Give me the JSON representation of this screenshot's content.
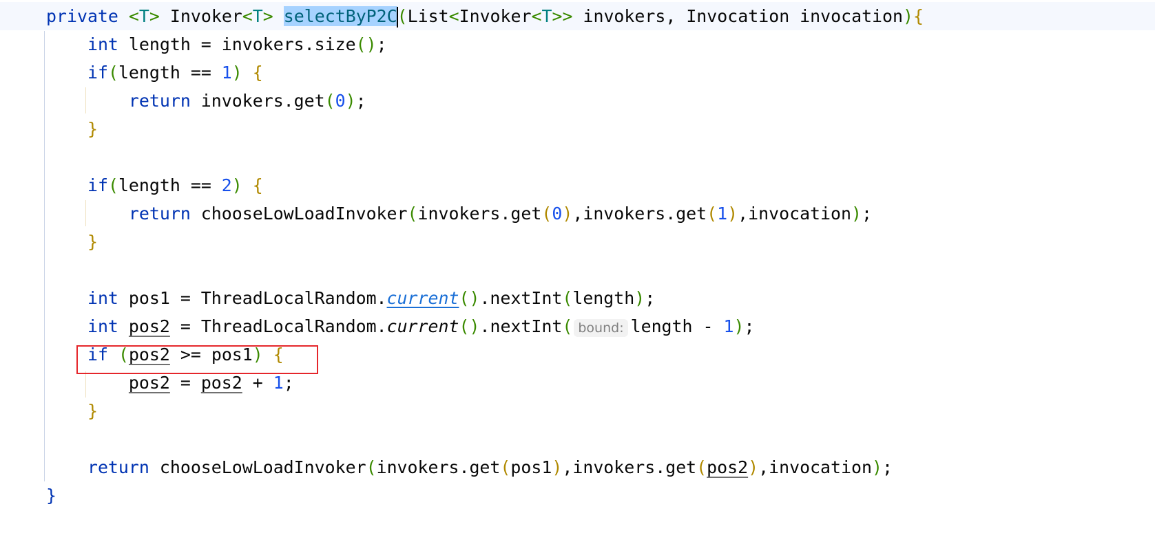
{
  "editor": {
    "lines": [
      [
        {
          "t": "private",
          "c": "kw"
        },
        {
          "t": " "
        },
        {
          "t": "<",
          "c": "ang"
        },
        {
          "t": "T",
          "c": "gen"
        },
        {
          "t": ">",
          "c": "ang"
        },
        {
          "t": " Invoker"
        },
        {
          "t": "<",
          "c": "ang"
        },
        {
          "t": "T",
          "c": "gen"
        },
        {
          "t": ">",
          "c": "ang"
        },
        {
          "t": " "
        },
        {
          "t": "selectByP2C",
          "c": "decl"
        },
        {
          "t": "",
          "c": "caret"
        },
        {
          "t": "(",
          "c": "p1"
        },
        {
          "t": "List"
        },
        {
          "t": "<",
          "c": "ang"
        },
        {
          "t": "Invoker"
        },
        {
          "t": "<",
          "c": "ang"
        },
        {
          "t": "T",
          "c": "gen"
        },
        {
          "t": ">>",
          "c": "ang"
        },
        {
          "t": " invokers, Invocation invocation"
        },
        {
          "t": ")",
          "c": "p1"
        },
        {
          "t": "{",
          "c": "br"
        }
      ],
      [
        {
          "t": "    "
        },
        {
          "t": "int",
          "c": "kw"
        },
        {
          "t": " length = invokers.size"
        },
        {
          "t": "()",
          "c": "p1"
        },
        {
          "t": ";"
        }
      ],
      [
        {
          "t": "    "
        },
        {
          "t": "if",
          "c": "kw"
        },
        {
          "t": "(",
          "c": "p1"
        },
        {
          "t": "length == "
        },
        {
          "t": "1",
          "c": "num"
        },
        {
          "t": ")",
          "c": "p1"
        },
        {
          "t": " "
        },
        {
          "t": "{",
          "c": "br"
        }
      ],
      [
        {
          "t": "        "
        },
        {
          "t": "return",
          "c": "kw"
        },
        {
          "t": " invokers.get"
        },
        {
          "t": "(",
          "c": "p1"
        },
        {
          "t": "0",
          "c": "num"
        },
        {
          "t": ")",
          "c": "p1"
        },
        {
          "t": ";"
        }
      ],
      [
        {
          "t": "    "
        },
        {
          "t": "}",
          "c": "br"
        }
      ],
      [],
      [
        {
          "t": "    "
        },
        {
          "t": "if",
          "c": "kw"
        },
        {
          "t": "(",
          "c": "p1"
        },
        {
          "t": "length == "
        },
        {
          "t": "2",
          "c": "num"
        },
        {
          "t": ")",
          "c": "p1"
        },
        {
          "t": " "
        },
        {
          "t": "{",
          "c": "br"
        }
      ],
      [
        {
          "t": "        "
        },
        {
          "t": "return",
          "c": "kw"
        },
        {
          "t": " chooseLowLoadInvoker"
        },
        {
          "t": "(",
          "c": "p1"
        },
        {
          "t": "invokers.get"
        },
        {
          "t": "(",
          "c": "br"
        },
        {
          "t": "0",
          "c": "num"
        },
        {
          "t": ")",
          "c": "br"
        },
        {
          "t": ",invokers.get"
        },
        {
          "t": "(",
          "c": "br"
        },
        {
          "t": "1",
          "c": "num"
        },
        {
          "t": ")",
          "c": "br"
        },
        {
          "t": ",invocation"
        },
        {
          "t": ")",
          "c": "p1"
        },
        {
          "t": ";"
        }
      ],
      [
        {
          "t": "    "
        },
        {
          "t": "}",
          "c": "br"
        }
      ],
      [],
      [
        {
          "t": "    "
        },
        {
          "t": "int",
          "c": "kw"
        },
        {
          "t": " pos1 = ThreadLocalRandom."
        },
        {
          "t": "current",
          "c": "link"
        },
        {
          "t": "()",
          "c": "p1"
        },
        {
          "t": ".nextInt"
        },
        {
          "t": "(",
          "c": "p1"
        },
        {
          "t": "length"
        },
        {
          "t": ")",
          "c": "p1"
        },
        {
          "t": ";"
        }
      ],
      [
        {
          "t": "    "
        },
        {
          "t": "int",
          "c": "kw"
        },
        {
          "t": " "
        },
        {
          "t": "pos2",
          "c": "reass"
        },
        {
          "t": " = ThreadLocalRandom."
        },
        {
          "t": "current",
          "c": "ital"
        },
        {
          "t": "()",
          "c": "p1"
        },
        {
          "t": ".nextInt"
        },
        {
          "t": "(",
          "c": "p1"
        },
        {
          "t": "bound:",
          "c": "hint"
        },
        {
          "t": "length - "
        },
        {
          "t": "1",
          "c": "num"
        },
        {
          "t": ")",
          "c": "p1"
        },
        {
          "t": ";"
        }
      ],
      [
        {
          "t": "    "
        },
        {
          "t": "if",
          "c": "kw"
        },
        {
          "t": " "
        },
        {
          "t": "(",
          "c": "p1"
        },
        {
          "t": "pos2",
          "c": "reass"
        },
        {
          "t": " >= pos1"
        },
        {
          "t": ")",
          "c": "p1"
        },
        {
          "t": " "
        },
        {
          "t": "{",
          "c": "br"
        }
      ],
      [
        {
          "t": "        "
        },
        {
          "t": "pos2",
          "c": "reass"
        },
        {
          "t": " = "
        },
        {
          "t": "pos2",
          "c": "reass"
        },
        {
          "t": " + "
        },
        {
          "t": "1",
          "c": "num"
        },
        {
          "t": ";"
        }
      ],
      [
        {
          "t": "    "
        },
        {
          "t": "}",
          "c": "br"
        }
      ],
      [],
      [
        {
          "t": "    "
        },
        {
          "t": "return",
          "c": "kw"
        },
        {
          "t": " chooseLowLoadInvoker"
        },
        {
          "t": "(",
          "c": "p1"
        },
        {
          "t": "invokers.get"
        },
        {
          "t": "(",
          "c": "br"
        },
        {
          "t": "pos1"
        },
        {
          "t": ")",
          "c": "br"
        },
        {
          "t": ",invokers.get"
        },
        {
          "t": "(",
          "c": "br"
        },
        {
          "t": "pos2",
          "c": "reass"
        },
        {
          "t": ")",
          "c": "br"
        },
        {
          "t": ",invocation"
        },
        {
          "t": ")",
          "c": "p1"
        },
        {
          "t": ";"
        }
      ],
      [
        {
          "t": "}",
          "c": "kw"
        }
      ]
    ],
    "colors": {
      "highlight_box": "#e5262b",
      "selection": "#a6d2ff",
      "caret_line": "#f5f8fe"
    }
  }
}
